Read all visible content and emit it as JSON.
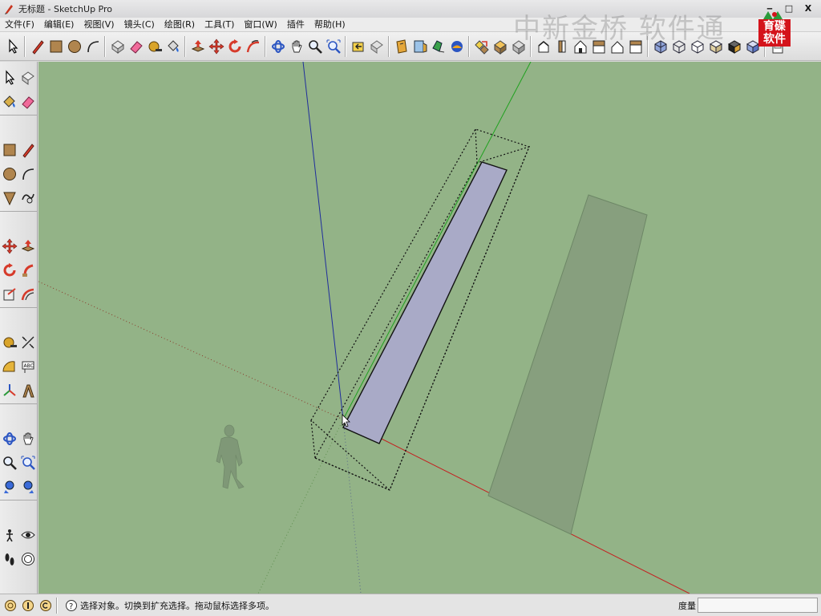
{
  "window": {
    "title": "无标题 - SketchUp Pro",
    "minimize": "‒",
    "maximize": "□",
    "close": "X"
  },
  "menu": {
    "items": [
      "文件(F)",
      "编辑(E)",
      "视图(V)",
      "镜头(C)",
      "绘图(R)",
      "工具(T)",
      "窗口(W)",
      "插件",
      "帮助(H)"
    ]
  },
  "watermark": {
    "text": "中新金桥 软件通",
    "logo_text": "育碟软件"
  },
  "statusbar": {
    "message": "选择对象。切换到扩充选择。拖动鼠标选择多项。",
    "measure_label": "度量",
    "measure_value": ""
  },
  "colors": {
    "viewport_bg": "#93b387",
    "face_front": "#a9aac7",
    "face_shadow": "#879f7e",
    "axis_red": "#c42020",
    "axis_green": "#1fa11f",
    "axis_blue": "#1f2d9c"
  },
  "icons": {
    "top_toolbar": [
      "select-icon",
      "pencil-icon",
      "rectangle-icon",
      "circle-icon",
      "arc-icon",
      "make-component-icon",
      "eraser-icon",
      "tape-measure-icon",
      "paint-bucket-icon",
      "push-pull-icon",
      "move-icon",
      "rotate-icon",
      "follow-me-icon",
      "orbit-icon",
      "pan-icon",
      "zoom-icon",
      "zoom-extents-icon",
      "previous-view-icon",
      "next-view-icon",
      "section-plane-icon",
      "walk-icon",
      "position-camera-icon",
      "look-around-icon",
      "layer-icon",
      "iso-view-icon",
      "top-view-icon",
      "front-view-icon",
      "right-view-icon",
      "back-view-icon",
      "left-view-icon",
      "xray-icon",
      "wireframe-icon",
      "hidden-line-icon",
      "shaded-icon",
      "shaded-texture-icon",
      "monochrome-icon",
      "settings-icon"
    ],
    "left_toolbar": [
      "select-icon",
      "make-component-icon",
      "paint-bucket-icon",
      "eraser-icon",
      "rectangle-icon",
      "line-icon",
      "circle-icon",
      "arc-icon",
      "polygon-icon",
      "freehand-icon",
      "move-icon",
      "push-pull-icon",
      "rotate-icon",
      "follow-me-icon",
      "scale-icon",
      "offset-icon",
      "tape-measure-icon",
      "dimension-icon",
      "protractor-icon",
      "text-icon",
      "axes-icon",
      "3d-text-icon",
      "orbit-icon",
      "pan-icon",
      "zoom-icon",
      "zoom-window-icon",
      "zoom-extents-icon",
      "previous-view-icon",
      "position-camera-icon",
      "look-around-icon",
      "walk-icon",
      "section-icon"
    ]
  }
}
